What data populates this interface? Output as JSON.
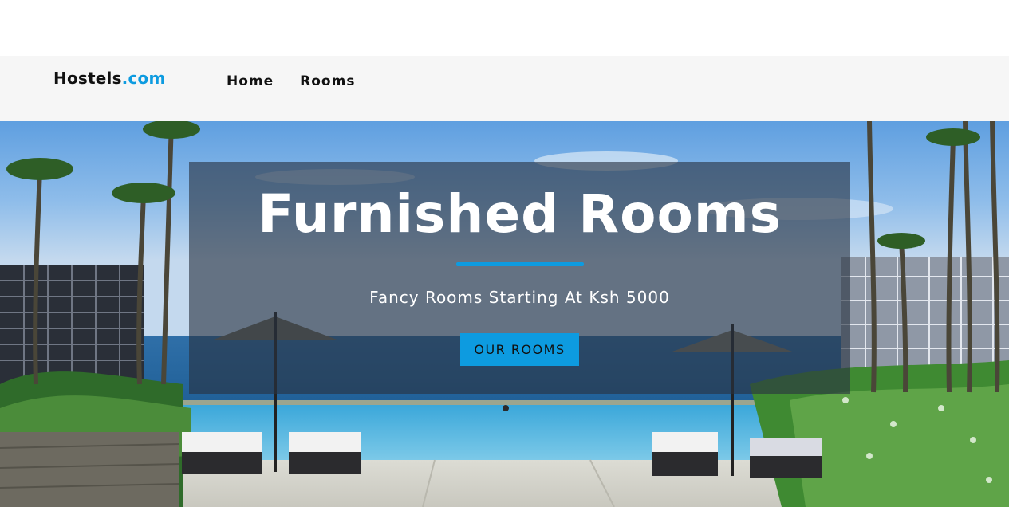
{
  "header": {
    "logo_main": "Hostels",
    "logo_accent": ".com"
  },
  "nav": {
    "items": [
      {
        "label": "Home"
      },
      {
        "label": "Rooms"
      }
    ]
  },
  "hero": {
    "title": "Furnished Rooms",
    "subtitle": "Fancy Rooms Starting At Ksh 5000",
    "button_label": "OUR ROOMS"
  },
  "colors": {
    "accent": "#0d9be0",
    "navbar_bg": "#f6f6f6",
    "banner_overlay": "rgba(40,50,64,0.62)"
  }
}
